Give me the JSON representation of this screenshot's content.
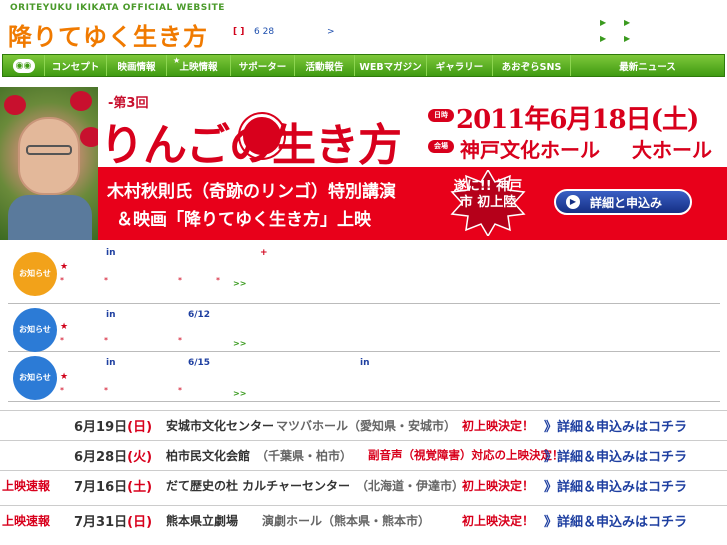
{
  "header": {
    "site_en": "ORITEYUKU IKIKATA OFFICIAL WEBSITE",
    "site_title": "降りてゆく生き方",
    "news_bracket": "[ ]",
    "news_date": "6 28",
    "news_arrow": ">",
    "header_links": [
      "▶",
      "▶",
      "▶",
      "▶"
    ]
  },
  "nav": {
    "logo": "◉◉",
    "items": [
      "コンセプト",
      "映画情報",
      "上映情報",
      "サポーター",
      "活動報告",
      "WEBマガジン",
      "ギャラリー",
      "あおぞらSNS",
      "最新ニュース"
    ],
    "star": "★"
  },
  "banner": {
    "kicker": "-第3回",
    "title": "りんごの生き方",
    "badge_date": "日時",
    "badge_venue": "会場",
    "date": "2011年6月18日(土)",
    "venue": "神戸文化ホール",
    "hall": "大ホール",
    "line1": "木村秋則氏（奇跡のリンゴ）特別講演",
    "line2": "＆映画「降りてゆく生き方」上映",
    "burst": "遂に!! 神戸市 初上陸",
    "cta_label": "詳細と申込み",
    "cta_icon": "▶",
    "colors": {
      "red": "#e8001a",
      "navy": "#152f84"
    }
  },
  "notices": [
    {
      "badge": "お知らせ",
      "color": "#f2a21a",
      "star": "★",
      "in": "in",
      "extra": "+",
      "dots": [
        "*",
        "*",
        "*",
        "*"
      ],
      "more": ">>"
    },
    {
      "badge": "お知らせ",
      "color": "#2c7bd6",
      "star": "★",
      "in": "in",
      "date": "6/12",
      "dots": [
        "*",
        "*",
        "*"
      ],
      "more": ">>"
    },
    {
      "badge": "お知らせ",
      "color": "#2c7bd6",
      "star": "★",
      "in": "in",
      "date": "6/15",
      "in2": "in",
      "dots": [
        "*",
        "*",
        "*"
      ],
      "more": ">>"
    }
  ],
  "screenings": [
    {
      "flash": "",
      "date": "6月19日",
      "day": "(日)",
      "venue": "安城市文化センター",
      "hall": "マツバホール（愛知県・安城市）",
      "note": "初上映決定！",
      "link": "》詳細＆申込みはコチラ"
    },
    {
      "flash": "",
      "date": "6月28日",
      "day": "(火)",
      "venue": "柏市民文化会館",
      "hall": "（千葉県・柏市）",
      "note": "副音声（視覚障害）対応の上映決定！",
      "link": "》詳細＆申込みはコチラ"
    },
    {
      "flash": "上映速報",
      "date": "7月16日",
      "day": "(土)",
      "venue": "だて歴史の杜 カルチャーセンター",
      "hall": "（北海道・伊達市）",
      "note": "初上映決定！",
      "link": "》詳細＆申込みはコチラ"
    },
    {
      "flash": "上映速報",
      "date": "7月31日",
      "day": "(日)",
      "venue": "熊本県立劇場",
      "hall": "演劇ホール（熊本県・熊本市）",
      "note": "初上映決定！",
      "link": "》詳細＆申込みはコチラ"
    }
  ]
}
